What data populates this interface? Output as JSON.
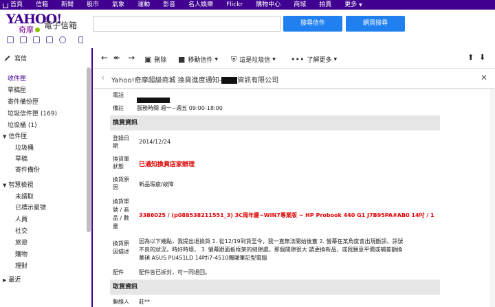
{
  "topnav": {
    "items": [
      "首頁",
      "信箱",
      "新聞",
      "股市",
      "氣象",
      "運動",
      "影音",
      "名人娛樂",
      "Flickr",
      "購物中心",
      "商城",
      "拍賣",
      "更多"
    ],
    "more_caret": "▼"
  },
  "header": {
    "logo_text": "YAHOO!",
    "logo_sub": "奇摩",
    "mail_title": "電子信箱",
    "search_placeholder": "",
    "btn_search_mail": "搜尋信件",
    "btn_search_web": "網頁搜尋"
  },
  "sidebar": {
    "compose": "寫信",
    "items": [
      {
        "label": "收件匣",
        "active": true
      },
      {
        "label": "草稿匣"
      },
      {
        "label": "寄件備份匣"
      },
      {
        "label": "垃圾信件匣 (169)"
      },
      {
        "label": "垃圾桶 (1)"
      },
      {
        "label": "信件匣",
        "caret": "▼"
      },
      {
        "label": "垃圾桶",
        "sub": true
      },
      {
        "label": "草稿",
        "sub": true
      },
      {
        "label": "寄件備份",
        "sub": true
      },
      {
        "label": "智慧檢視",
        "caret": "▼"
      },
      {
        "label": "未讀取",
        "sub": true
      },
      {
        "label": "已標示星號",
        "sub": true
      },
      {
        "label": "人員",
        "sub": true
      },
      {
        "label": "社交",
        "sub": true
      },
      {
        "label": "旅遊",
        "sub": true
      },
      {
        "label": "購物",
        "sub": true
      },
      {
        "label": "理財",
        "sub": true
      },
      {
        "label": "最近",
        "caret": "▶"
      }
    ]
  },
  "toolbar": {
    "delete": "刪除",
    "move": "移動信件",
    "spam": "這是垃圾信",
    "more": "了解更多"
  },
  "subject": {
    "prefix": "Yahoo!奇摩超級商城 換貨進度通知-",
    "suffix": "資訊有限公司"
  },
  "content": {
    "phone_label": "電話",
    "note_label": "備註",
    "note_value": "服務時間 週一~週五 09:00-18:00",
    "section_exchange": "換貨資訊",
    "date_label": [
      "登錄日",
      "期"
    ],
    "date_value": "2014/12/24",
    "status_label": [
      "換貨單",
      "狀態"
    ],
    "status_value": "已通知換貨店家辦理",
    "reason_label": [
      "換貨原",
      "因"
    ],
    "reason_value": "新品瑕疵/故障",
    "order_label": [
      "換貨單",
      "號 / 商",
      "品 / 數",
      "量"
    ],
    "order_value": "3386025 / (p088538211551_3) 3C周年慶~WIN7專業版 ~ HP Probook 440 G1 J7B95PA#AB0 14吋 / 1",
    "desc_label": [
      "換貨原",
      "因描述"
    ],
    "desc_lines": [
      "因為以下幾點，我提出退換貨 1. 從12/19到貨至今，我一直無法開始後蓋 2. 螢幕在某角度會出現斷訊、訊號",
      "不良的狀況，時好時壞， 3. 螢幕跟面板框架的縫隙處，那個間隙很大 請更換新品，或我願意平價或補差額換",
      "華碩 ASUS PU451LD 14吋i7-4510獨顯筆記型電腦"
    ],
    "parts_label": "配件",
    "parts_value": "配件皆已拆封，可一同退回。",
    "section_pickup": "取貨資訊",
    "contact_label": "聯絡人",
    "contact_value": "莊**"
  }
}
